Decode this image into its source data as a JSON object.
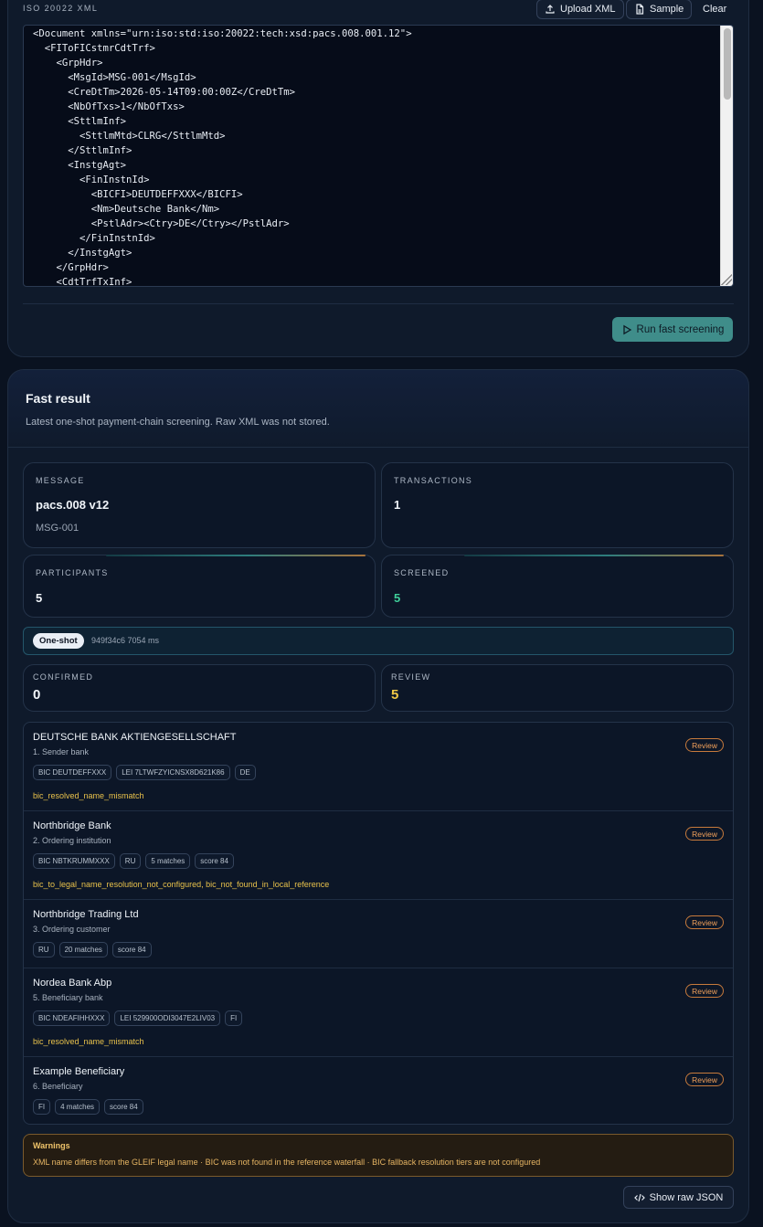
{
  "editor": {
    "section_label": "ISO 20022 XML",
    "upload_label": "Upload XML",
    "sample_label": "Sample",
    "clear_label": "Clear",
    "xml": "<Document xmlns=\"urn:iso:std:iso:20022:tech:xsd:pacs.008.001.12\">\n  <FIToFICstmrCdtTrf>\n    <GrpHdr>\n      <MsgId>MSG-001</MsgId>\n      <CreDtTm>2026-05-14T09:00:00Z</CreDtTm>\n      <NbOfTxs>1</NbOfTxs>\n      <SttlmInf>\n        <SttlmMtd>CLRG</SttlmMtd>\n      </SttlmInf>\n      <InstgAgt>\n        <FinInstnId>\n          <BICFI>DEUTDEFFXXX</BICFI>\n          <Nm>Deutsche Bank</Nm>\n          <PstlAdr><Ctry>DE</Ctry></PstlAdr>\n        </FinInstnId>\n      </InstgAgt>\n    </GrpHdr>\n    <CdtTrfTxInf>",
    "run_label": "Run fast screening"
  },
  "result": {
    "title": "Fast result",
    "subtitle": "Latest one-shot payment-chain screening. Raw XML was not stored.",
    "stats": {
      "message_label": "MESSAGE",
      "message_value": "pacs.008 v12",
      "message_sub": "MSG-001",
      "transactions_label": "TRANSACTIONS",
      "transactions_value": "1",
      "participants_label": "PARTICIPANTS",
      "participants_value": "5",
      "screened_label": "SCREENED",
      "screened_value": "5"
    },
    "run": {
      "mode": "One-shot",
      "meta": "949f34c6  7054 ms"
    },
    "counts": {
      "confirmed_label": "CONFIRMED",
      "confirmed_value": "0",
      "review_label": "REVIEW",
      "review_value": "5"
    },
    "participants": [
      {
        "name": "DEUTSCHE BANK AKTIENGESELLSCHAFT",
        "role": "1. Sender bank",
        "status": "Review",
        "tags": [
          "BIC DEUTDEFFXXX",
          "LEI 7LTWFZYICNSX8D621K86",
          "DE"
        ],
        "flags": "bic_resolved_name_mismatch"
      },
      {
        "name": "Northbridge Bank",
        "role": "2. Ordering institution",
        "status": "Review",
        "tags": [
          "BIC NBTKRUMMXXX",
          "RU",
          "5 matches",
          "score 84"
        ],
        "flags": "bic_to_legal_name_resolution_not_configured, bic_not_found_in_local_reference"
      },
      {
        "name": "Northbridge Trading Ltd",
        "role": "3. Ordering customer",
        "status": "Review",
        "tags": [
          "RU",
          "20 matches",
          "score 84"
        ],
        "flags": ""
      },
      {
        "name": "Nordea Bank Abp",
        "role": "5. Beneficiary bank",
        "status": "Review",
        "tags": [
          "BIC NDEAFIHHXXX",
          "LEI 529900ODI3047E2LIV03",
          "FI"
        ],
        "flags": "bic_resolved_name_mismatch"
      },
      {
        "name": "Example Beneficiary",
        "role": "6. Beneficiary",
        "status": "Review",
        "tags": [
          "FI",
          "4 matches",
          "score 84"
        ],
        "flags": ""
      }
    ],
    "warnings": {
      "title": "Warnings",
      "text": "XML name differs from the GLEIF legal name · BIC was not found in the reference waterfall · BIC fallback resolution tiers are not configured"
    },
    "raw_json_label": "Show raw JSON"
  },
  "colors": {
    "accent": "#3f8d8a",
    "review": "#f0a05a",
    "flag": "#e9c24b",
    "screened": "#3fcf9a"
  }
}
